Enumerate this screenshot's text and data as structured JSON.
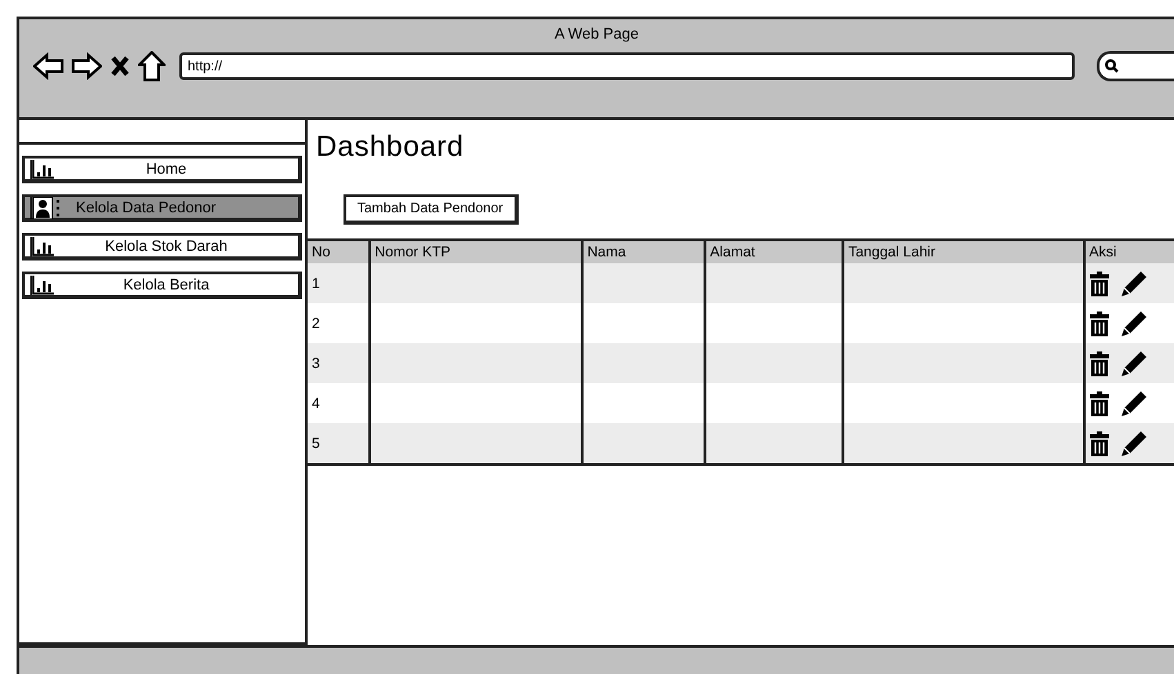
{
  "window": {
    "title": "A Web Page",
    "url": "http://"
  },
  "sidebar": {
    "items": [
      {
        "label": "Home",
        "kind": "chart",
        "selected": false
      },
      {
        "label": "Kelola Data Pedonor",
        "kind": "person",
        "selected": true
      },
      {
        "label": "Kelola Stok Darah",
        "kind": "chart",
        "selected": false
      },
      {
        "label": "Kelola Berita",
        "kind": "chart",
        "selected": false
      }
    ]
  },
  "page": {
    "title": "Dashboard",
    "add_button": "Tambah Data Pendonor"
  },
  "table": {
    "columns": [
      "No",
      "Nomor KTP",
      "Nama",
      "Alamat",
      "Tanggal Lahir",
      "Aksi"
    ],
    "rows": [
      {
        "no": "1"
      },
      {
        "no": "2"
      },
      {
        "no": "3"
      },
      {
        "no": "4"
      },
      {
        "no": "5"
      }
    ]
  }
}
